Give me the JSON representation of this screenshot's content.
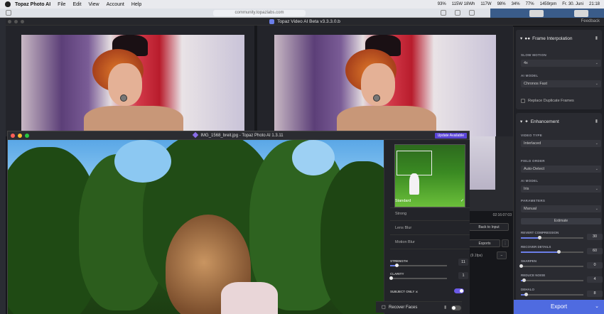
{
  "menubar": {
    "app_name": "Topaz Photo AI",
    "items": [
      "File",
      "Edit",
      "View",
      "Account",
      "Help"
    ],
    "status": [
      "93%",
      "115W 18Wh",
      "117W",
      "98%",
      "34%",
      "77%",
      "1459rpm"
    ],
    "date": "Fr. 30. Juni",
    "time": "21:18"
  },
  "browser": {
    "url": "community.topazlabs.com"
  },
  "video_window": {
    "title": "Topaz Video AI Beta  v3.3.3.0.b",
    "feedback": "Feedback",
    "timecode": "02:16:07:03",
    "back_to_input": "Back to Input",
    "exports": "Exports",
    "fps": "(9.1fps)"
  },
  "video_panel": {
    "frame_interp": {
      "title": "Frame Interpolation",
      "slow_motion_label": "SLOW MOTION",
      "slow_motion_value": "4x",
      "ai_model_label": "AI MODEL",
      "ai_model_value": "Chronos Fast",
      "replace_dup": "Replace Duplicate Frames"
    },
    "enhancement": {
      "title": "Enhancement",
      "video_type_label": "VIDEO TYPE",
      "video_type_value": "Interlaced",
      "field_order_label": "FIELD ORDER",
      "field_order_value": "Auto-Detect",
      "ai_model_label": "AI MODEL",
      "ai_model_value": "Iris",
      "parameters_label": "PARAMETERS",
      "parameters_value": "Manual",
      "estimate": "Estimate",
      "sliders": [
        {
          "label": "REVERT COMPRESSION",
          "value": "30",
          "level": 0.3
        },
        {
          "label": "RECOVER DETAILS",
          "value": "60",
          "level": 0.6
        },
        {
          "label": "SHARPEN",
          "value": "0",
          "level": 0.0
        },
        {
          "label": "REDUCE NOISE",
          "value": "4",
          "level": 0.04
        },
        {
          "label": "DEHALO",
          "value": "8",
          "level": 0.08
        }
      ]
    },
    "export_label": "Export"
  },
  "photo_window": {
    "title": "IMG_1568_breit.jpg - Topaz Photo AI 1.3.11",
    "update": "Update Available",
    "models": [
      {
        "label": "Standard",
        "selected": true
      },
      {
        "label": "Strong",
        "selected": false
      },
      {
        "label": "Lens Blur",
        "selected": false
      },
      {
        "label": "Motion Blur",
        "selected": false
      }
    ],
    "strength_label": "STRENGTH",
    "strength_value": "11",
    "strength_level": 0.11,
    "clarity_label": "CLARITY",
    "clarity_value": "1",
    "clarity_level": 0.01,
    "subject_only_label": "SUBJECT ONLY",
    "recover_faces": "Recover Faces"
  },
  "colors": {
    "accent": "#4f6be0",
    "update": "#5a45d6",
    "toggle": "#6b5ae6"
  }
}
